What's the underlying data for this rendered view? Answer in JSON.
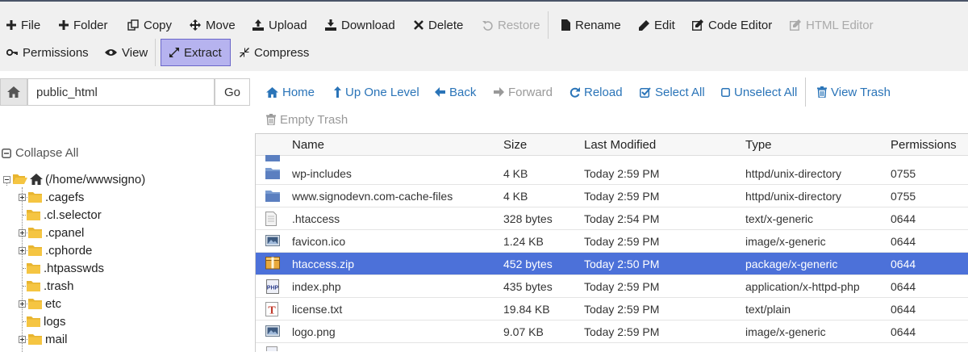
{
  "toolbar": {
    "file": "File",
    "folder": "Folder",
    "copy": "Copy",
    "move": "Move",
    "upload": "Upload",
    "download": "Download",
    "delete": "Delete",
    "restore": "Restore",
    "rename": "Rename",
    "edit": "Edit",
    "code_editor": "Code Editor",
    "html_editor": "HTML Editor",
    "permissions": "Permissions",
    "view": "View",
    "extract": "Extract",
    "compress": "Compress"
  },
  "path": {
    "value": "public_html",
    "go": "Go"
  },
  "nav": {
    "home": "Home",
    "up_one_level": "Up One Level",
    "back": "Back",
    "forward": "Forward",
    "reload": "Reload",
    "select_all": "Select All",
    "unselect_all": "Unselect All",
    "view_trash": "View Trash",
    "empty_trash": "Empty Trash"
  },
  "tree": {
    "collapse_all": "Collapse All",
    "root": "(/home/wwwsigno)",
    "items": [
      {
        "label": ".cagefs",
        "expandable": true
      },
      {
        "label": ".cl.selector",
        "expandable": false
      },
      {
        "label": ".cpanel",
        "expandable": true
      },
      {
        "label": ".cphorde",
        "expandable": true
      },
      {
        "label": ".htpasswds",
        "expandable": false
      },
      {
        "label": ".trash",
        "expandable": false
      },
      {
        "label": "etc",
        "expandable": true
      },
      {
        "label": "logs",
        "expandable": false
      },
      {
        "label": "mail",
        "expandable": true
      }
    ]
  },
  "table": {
    "headers": [
      "Name",
      "Size",
      "Last Modified",
      "Type",
      "Permissions"
    ],
    "rows": [
      {
        "icon": "folder",
        "name": "wp-includes",
        "size": "4 KB",
        "modified": "Today 2:59 PM",
        "type": "httpd/unix-directory",
        "perms": "0755",
        "selected": false
      },
      {
        "icon": "folder",
        "name": "www.signodevn.com-cache-files",
        "size": "4 KB",
        "modified": "Today 2:59 PM",
        "type": "httpd/unix-directory",
        "perms": "0755",
        "selected": false
      },
      {
        "icon": "text",
        "name": ".htaccess",
        "size": "328 bytes",
        "modified": "Today 2:54 PM",
        "type": "text/x-generic",
        "perms": "0644",
        "selected": false
      },
      {
        "icon": "image",
        "name": "favicon.ico",
        "size": "1.24 KB",
        "modified": "Today 2:59 PM",
        "type": "image/x-generic",
        "perms": "0644",
        "selected": false
      },
      {
        "icon": "package",
        "name": "htaccess.zip",
        "size": "452 bytes",
        "modified": "Today 2:50 PM",
        "type": "package/x-generic",
        "perms": "0644",
        "selected": true
      },
      {
        "icon": "php",
        "name": "index.php",
        "size": "435 bytes",
        "modified": "Today 2:59 PM",
        "type": "application/x-httpd-php",
        "perms": "0644",
        "selected": false
      },
      {
        "icon": "plain",
        "name": "license.txt",
        "size": "19.84 KB",
        "modified": "Today 2:59 PM",
        "type": "text/plain",
        "perms": "0644",
        "selected": false
      },
      {
        "icon": "image",
        "name": "logo.png",
        "size": "9.07 KB",
        "modified": "Today 2:59 PM",
        "type": "image/x-generic",
        "perms": "0644",
        "selected": false
      }
    ]
  },
  "colors": {
    "accent": "#2a74b8",
    "selected_row": "#4c71d9",
    "active_button": "#b6b3ef",
    "folder": "#f5c542"
  }
}
